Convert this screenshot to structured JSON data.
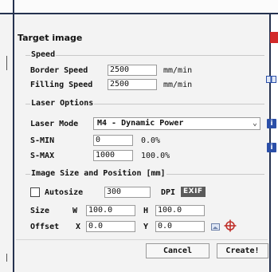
{
  "dialog": {
    "title": "Target image"
  },
  "speed": {
    "group_label": "Speed",
    "border_label": "Border Speed",
    "border_value": "2500",
    "border_unit": "mm/min",
    "filling_label": "Filling Speed",
    "filling_value": "2500",
    "filling_unit": "mm/min"
  },
  "laser": {
    "group_label": "Laser Options",
    "mode_label": "Laser Mode",
    "mode_value": "M4 - Dynamic Power",
    "smin_label": "S-MIN",
    "smin_value": "0",
    "smin_percent": "0.0%",
    "smax_label": "S-MAX",
    "smax_value": "1000",
    "smax_percent": "100.0%"
  },
  "size": {
    "group_label": "Image Size and Position [mm]",
    "autosize_label": "Autosize",
    "autosize_checked": false,
    "dpi_value": "300",
    "dpi_label": "DPI",
    "exif_label": "EXIF",
    "size_label": "Size",
    "w_label": "W",
    "w_value": "100.0",
    "h_label": "H",
    "h_value": "100.0",
    "offset_label": "Offset",
    "x_label": "X",
    "x_value": "0.0",
    "y_label": "Y",
    "y_value": "0.0"
  },
  "buttons": {
    "cancel": "Cancel",
    "create": "Create!"
  },
  "icons": {
    "info": "i",
    "colors": {
      "info": "#2b4fa8",
      "close": "#d32a2a",
      "crosshair": "#c0312b",
      "frame": "#25324f"
    }
  }
}
